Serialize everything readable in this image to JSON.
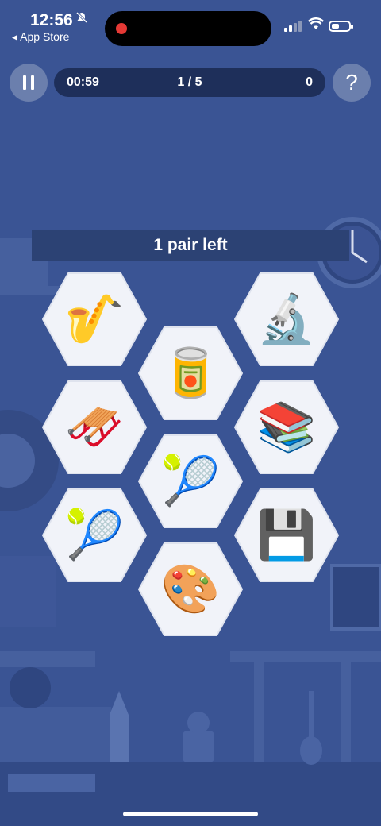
{
  "status_bar": {
    "time": "12:56",
    "back_label": "◂ App Store"
  },
  "game": {
    "timer": "00:59",
    "progress": "1 / 5",
    "score": "0",
    "help_label": "?",
    "pairs_left": "1 pair left"
  },
  "tiles": [
    {
      "item": "saxophone",
      "emoji": "🎷"
    },
    {
      "item": "microscope",
      "emoji": "🔬"
    },
    {
      "item": "canned-food",
      "emoji": "🥫"
    },
    {
      "item": "sled",
      "emoji": "🛷"
    },
    {
      "item": "books",
      "emoji": "📚"
    },
    {
      "item": "tennis-ball",
      "emoji": "🎾"
    },
    {
      "item": "tennis-ball",
      "emoji": "🎾"
    },
    {
      "item": "floppy-disk",
      "emoji": "💾"
    },
    {
      "item": "artist-palette",
      "emoji": "🎨"
    }
  ],
  "colors": {
    "background": "#3a5494",
    "bar": "#1e2f5a",
    "tile": "#f1f3f9"
  }
}
